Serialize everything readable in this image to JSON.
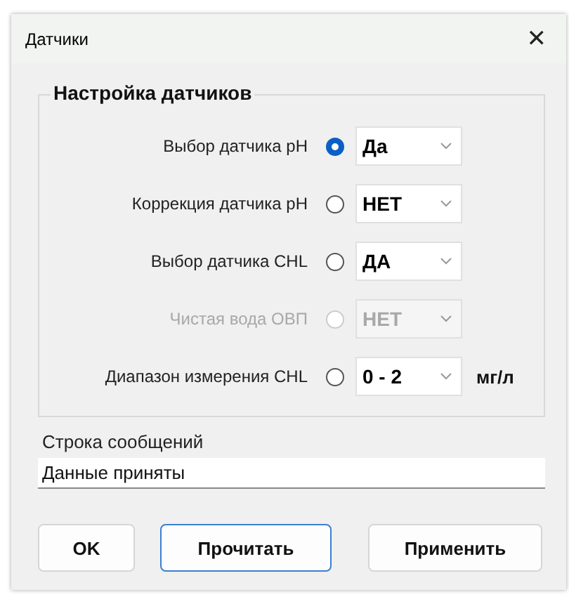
{
  "window": {
    "title": "Датчики",
    "close": "✕"
  },
  "group": {
    "title": "Настройка датчиков",
    "rows": [
      {
        "label": "Выбор датчика pH",
        "selected": true,
        "disabled": false,
        "value": "Да"
      },
      {
        "label": "Коррекция датчика pH",
        "selected": false,
        "disabled": false,
        "value": "НЕТ"
      },
      {
        "label": "Выбор датчика  CHL",
        "selected": false,
        "disabled": false,
        "value": "ДА"
      },
      {
        "label": "Чистая вода ОВП",
        "selected": false,
        "disabled": true,
        "value": "НЕТ"
      },
      {
        "label": "Диапазон измерения CHL",
        "selected": false,
        "disabled": false,
        "value": "0 - 2",
        "unit": "мг/л"
      }
    ]
  },
  "message": {
    "label": "Строка сообщений",
    "value": "Данные приняты"
  },
  "buttons": [
    {
      "label": "OK",
      "focused": false
    },
    {
      "label": "Прочитать",
      "focused": true
    },
    {
      "label": "Применить",
      "focused": false
    }
  ]
}
